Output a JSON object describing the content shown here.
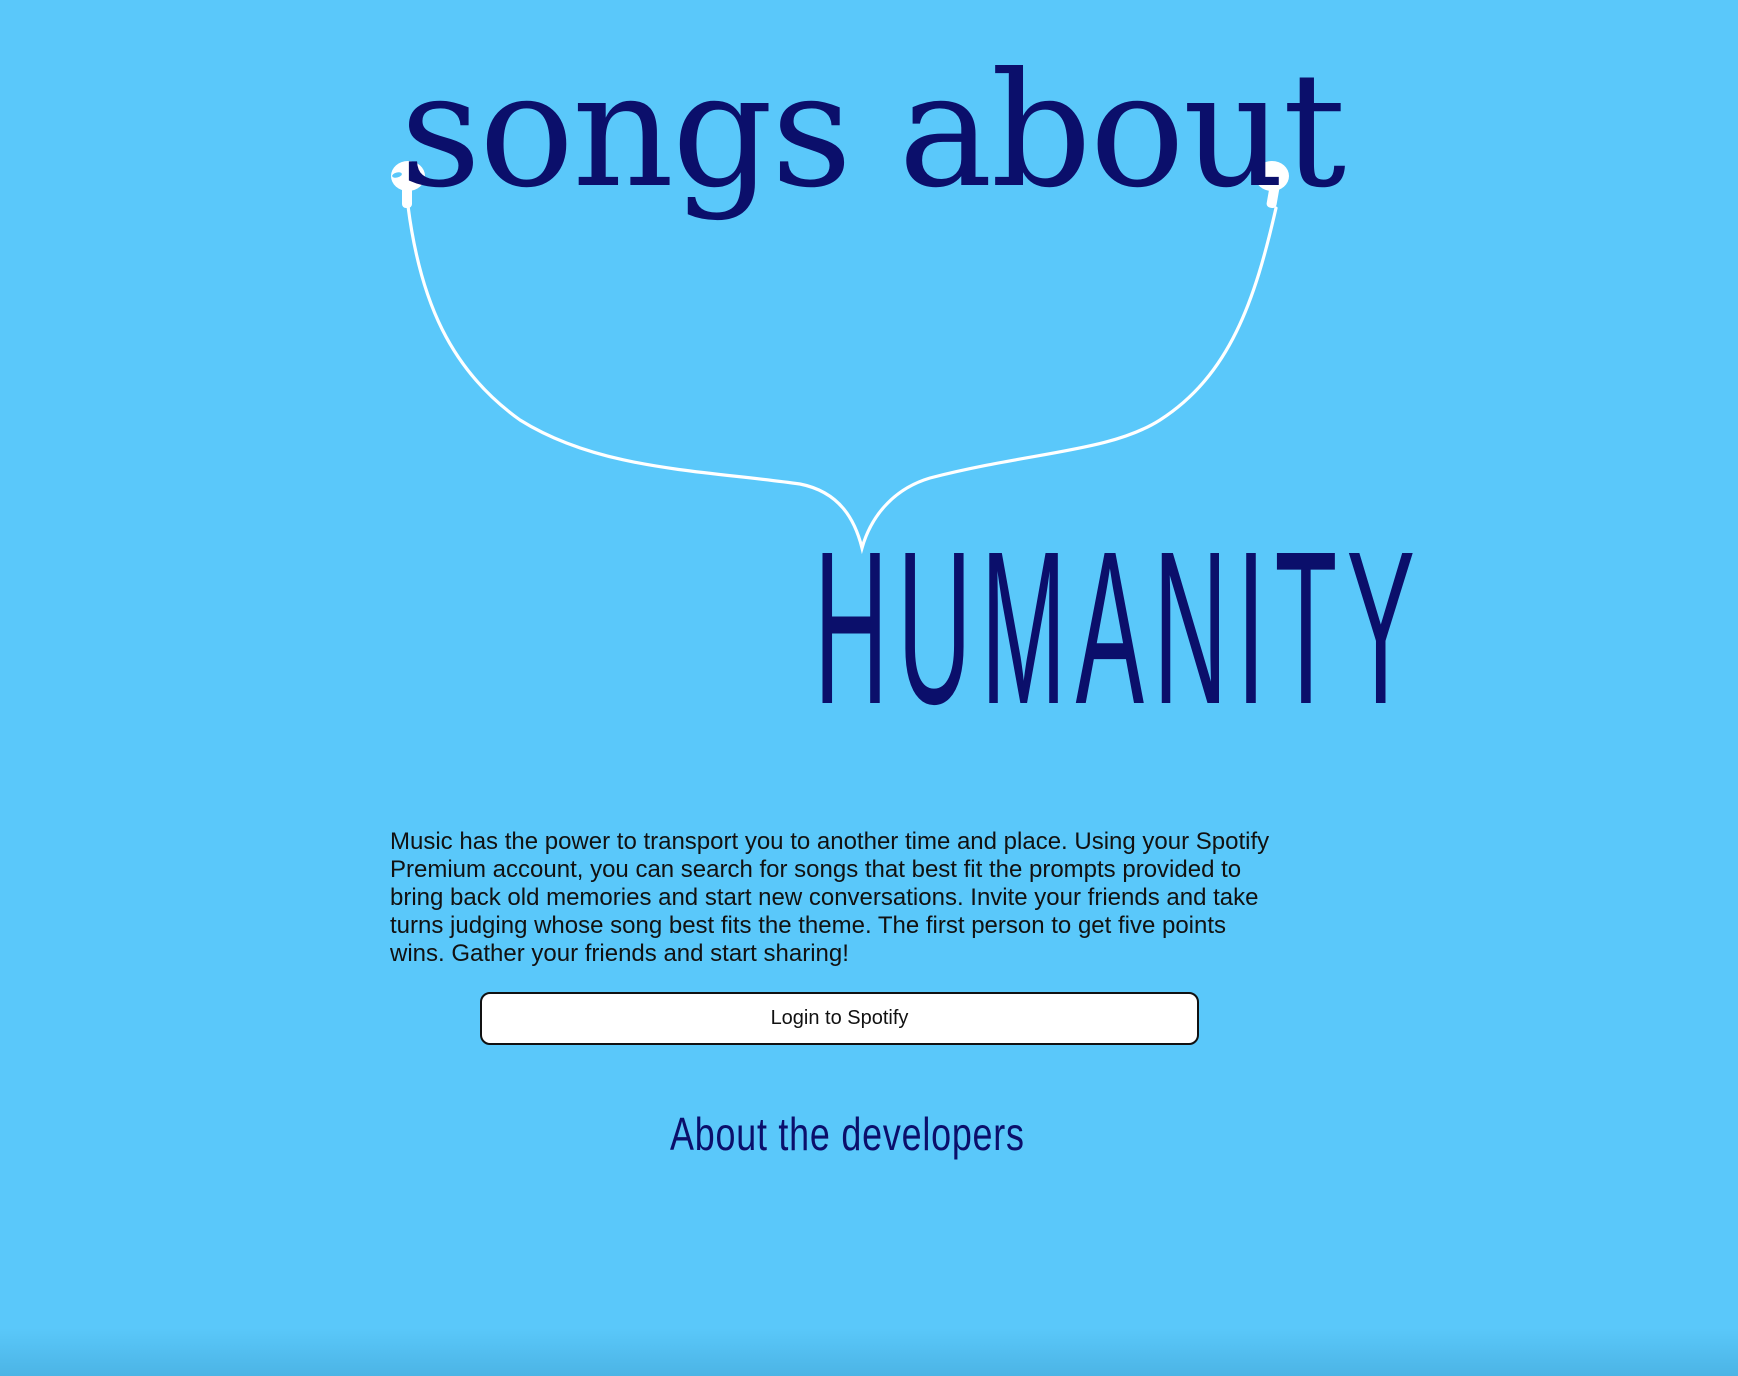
{
  "hero": {
    "title_top": "songs about",
    "title_main": "HUMANITY"
  },
  "intro": {
    "text": "Music has the power to transport you to another time and place. Using your Spotify Premium account, you can search for songs that best fit the prompts provided to bring back old memories and start new conversations. Invite your friends and take turns judging whose song best fits the theme. The first person to get five points wins. Gather your friends and start sharing!"
  },
  "actions": {
    "login_label": "Login to Spotify",
    "developers_link": "About the developers"
  },
  "colors": {
    "background": "#5ac8fa",
    "title": "#0b0f6b",
    "earphone_cord": "#ffffff",
    "button_bg": "#ffffff"
  },
  "icons": {
    "left_earbud": "earbud-icon",
    "right_earbud": "earbud-icon"
  }
}
